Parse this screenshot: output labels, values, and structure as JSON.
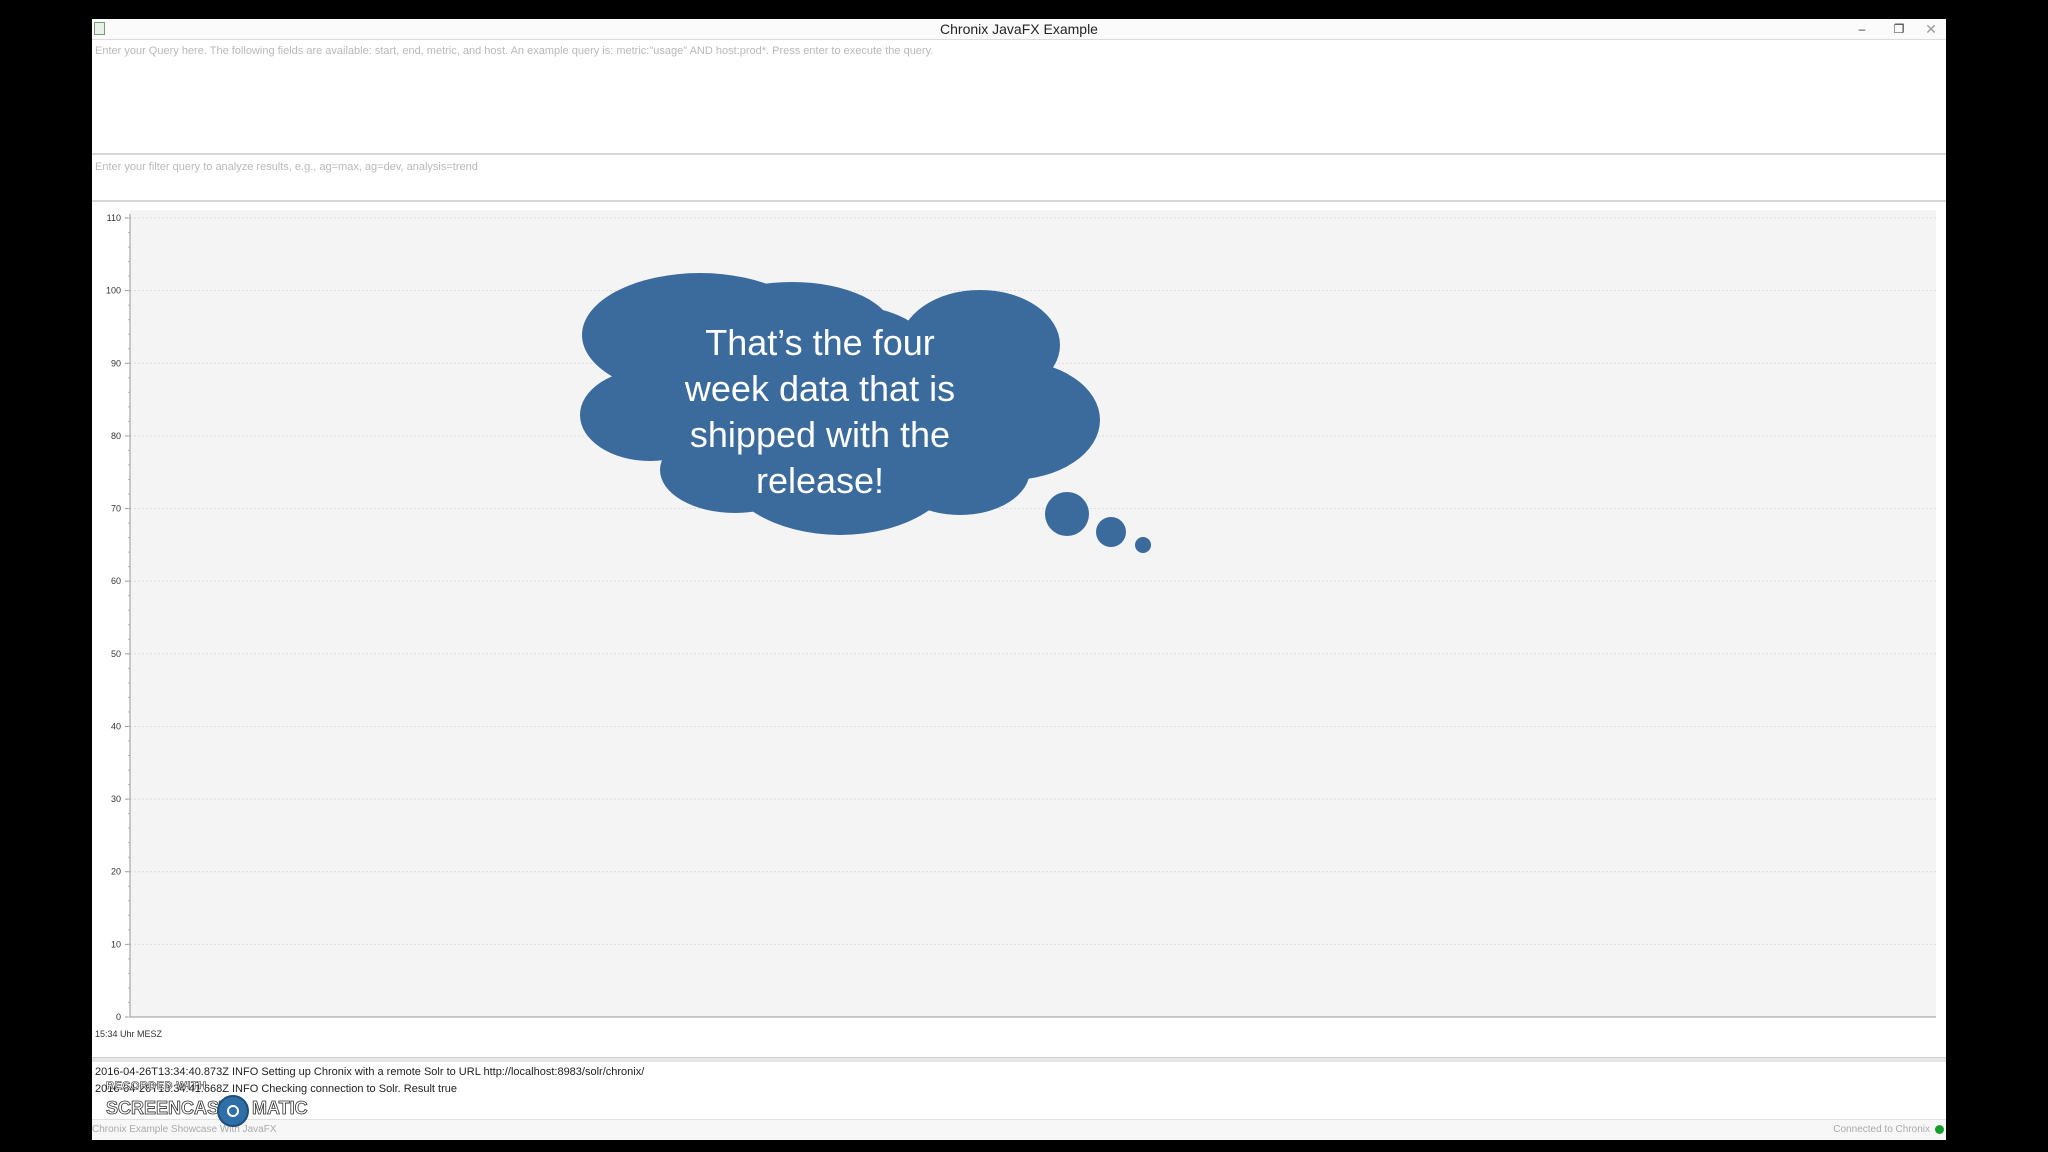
{
  "window": {
    "title": "Chronix JavaFX Example",
    "minimize_glyph": "–",
    "maximize_glyph": "❐",
    "close_glyph": "✕"
  },
  "query": {
    "placeholder": "Enter your Query here. The following fields are available: start, end, metric, and host. An example query is: metric:\"usage\" AND host:prod*. Press enter to execute the query."
  },
  "filter": {
    "placeholder": "Enter your filter query to analyze results, e.g., ag=max, ag=dev, analysis=trend"
  },
  "chart_data": {
    "type": "line",
    "series": [],
    "ylim": [
      0,
      110
    ],
    "y_ticks": [
      "0",
      "10",
      "20",
      "30",
      "40",
      "50",
      "60",
      "70",
      "80",
      "90",
      "100",
      "110"
    ],
    "x_ticks": [
      "15:34 Uhr MESZ"
    ],
    "grid": true
  },
  "callout": {
    "text": "That’s the four week data that is shipped with the release!",
    "lines": [
      "That’s the four",
      "week data that is",
      "shipped with the",
      "release!"
    ],
    "color": "#3b6b9c"
  },
  "log": {
    "lines": [
      "2016-04-26T13:34:40.873Z INFO Setting up Chronix with a remote Solr to URL http://localhost:8983/solr/chronix/",
      "2016-04-26T13:34:41.668Z INFO Checking connection to Solr. Result true"
    ]
  },
  "status": {
    "left": "Chronix Example Showcase With JavaFX",
    "right": "Connected to Chronix",
    "connected_color": "#1a9c2a"
  },
  "watermark": {
    "top": "RECORDED WITH",
    "left": "SCREENCAST",
    "right": "MATIC"
  }
}
